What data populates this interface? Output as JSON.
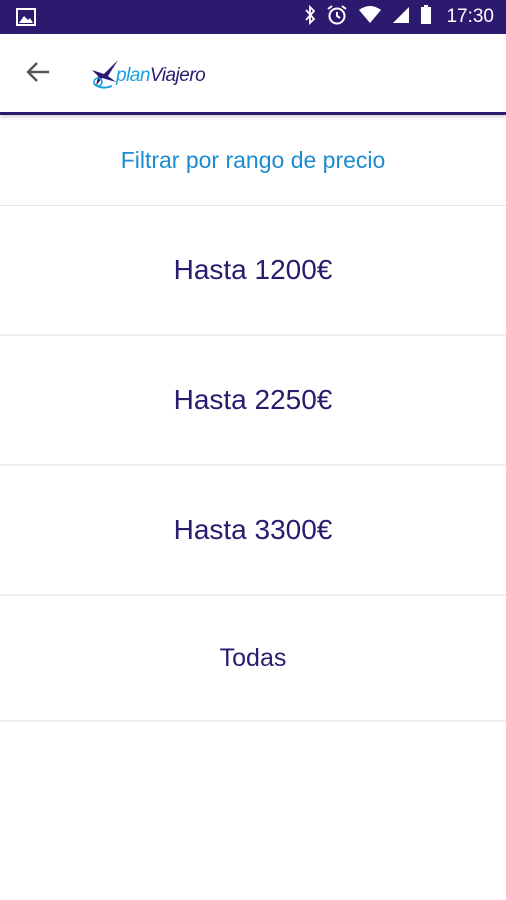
{
  "status_bar": {
    "time": "17:30",
    "icons": [
      "image-icon",
      "bluetooth-icon",
      "alarm-icon",
      "wifi-icon",
      "signal-icon",
      "battery-icon"
    ]
  },
  "app_bar": {
    "back_icon": "arrow-back-icon",
    "logo": {
      "plan": "plan",
      "viajero": "Viajero"
    }
  },
  "filter": {
    "title": "Filtrar por rango de precio",
    "options": [
      {
        "label": "Hasta 1200€"
      },
      {
        "label": "Hasta 2250€"
      },
      {
        "label": "Hasta 3300€"
      },
      {
        "label": "Todas"
      }
    ]
  },
  "colors": {
    "primary": "#2b1a6e",
    "accent": "#1c8bd1"
  }
}
